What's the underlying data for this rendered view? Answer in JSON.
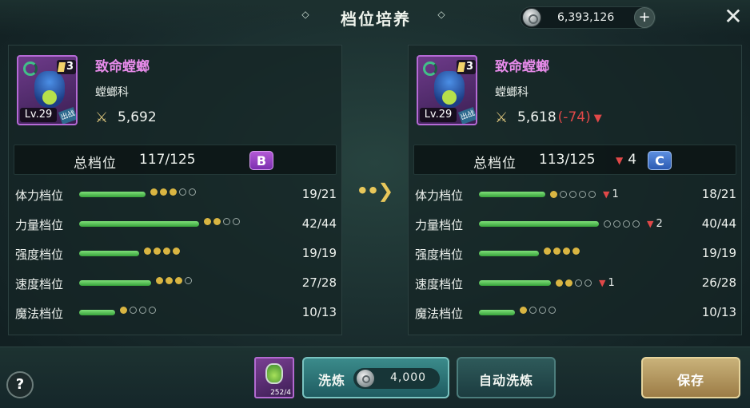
{
  "header": {
    "title": "档位培养",
    "currency_value": "6,393,126",
    "currency_icon": "silver-coin-icon",
    "plus_label": "+",
    "close_label": "✕"
  },
  "before": {
    "name": "致命螳螂",
    "family": "螳螂科",
    "stars": "3",
    "level": "Lv.29",
    "battle_tag": "出战",
    "power": "5,692",
    "total_label": "总档位",
    "total_value": "117/125",
    "grade": "B",
    "stats": [
      {
        "label": "体力档位",
        "value": "19/21",
        "fill": 0.55,
        "dots_on": 3,
        "dots_total": 5
      },
      {
        "label": "力量档位",
        "value": "42/44",
        "fill": 1.0,
        "dots_on": 2,
        "dots_total": 4
      },
      {
        "label": "强度档位",
        "value": "19/19",
        "fill": 0.5,
        "dots_on": 4,
        "dots_total": 4
      },
      {
        "label": "速度档位",
        "value": "27/28",
        "fill": 0.6,
        "dots_on": 3,
        "dots_total": 4
      },
      {
        "label": "魔法档位",
        "value": "10/13",
        "fill": 0.3,
        "dots_on": 1,
        "dots_total": 4
      }
    ]
  },
  "after": {
    "name": "致命螳螂",
    "family": "螳螂科",
    "stars": "3",
    "level": "Lv.29",
    "battle_tag": "出战",
    "power": "5,618",
    "power_diff": "(-74)",
    "total_label": "总档位",
    "total_value": "113/125",
    "total_drop": "4",
    "grade": "C",
    "stats": [
      {
        "label": "体力档位",
        "value": "18/21",
        "fill": 0.55,
        "dots_on": 1,
        "dots_total": 5,
        "drop": "1"
      },
      {
        "label": "力量档位",
        "value": "40/44",
        "fill": 1.0,
        "dots_on": 0,
        "dots_total": 4,
        "drop": "2"
      },
      {
        "label": "强度档位",
        "value": "19/19",
        "fill": 0.5,
        "dots_on": 4,
        "dots_total": 4,
        "drop": ""
      },
      {
        "label": "速度档位",
        "value": "26/28",
        "fill": 0.6,
        "dots_on": 2,
        "dots_total": 4,
        "drop": "1"
      },
      {
        "label": "魔法档位",
        "value": "10/13",
        "fill": 0.3,
        "dots_on": 1,
        "dots_total": 4,
        "drop": ""
      }
    ]
  },
  "footer": {
    "help_label": "?",
    "item_count": "252/4",
    "refine_label": "洗炼",
    "refine_cost": "4,000",
    "auto_refine_label": "自动洗炼",
    "save_label": "保存"
  },
  "colors": {
    "accent_gold": "#e8c75a",
    "grade_b": "#9b44c8",
    "grade_c": "#3f72cc",
    "bar_green": "#4cbc47",
    "drop_red": "#e04848",
    "name_pink": "#e78bea"
  }
}
